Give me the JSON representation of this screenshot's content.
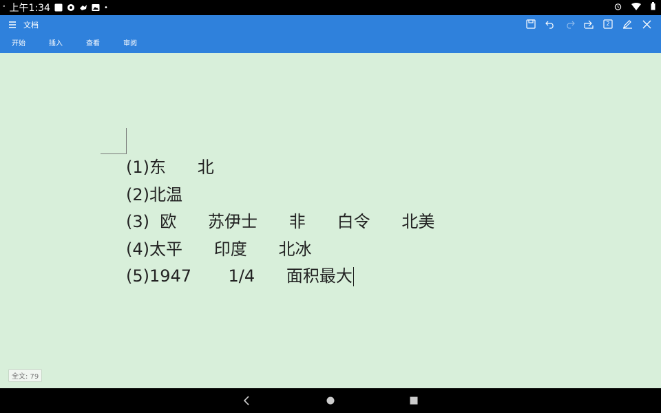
{
  "status_bar": {
    "time": "上午1:34",
    "left_dot": "°",
    "more_dot": "•"
  },
  "app_bar": {
    "title": "文档",
    "tabs": [
      {
        "label": "开始"
      },
      {
        "label": "插入"
      },
      {
        "label": "查看"
      },
      {
        "label": "审阅"
      }
    ],
    "page_badge": "2"
  },
  "document": {
    "lines": [
      "(1)东      北",
      "(2)北温",
      "(3)  欧      苏伊士      非      白令      北美",
      "(4)太平      印度      北冰",
      "(5)1947       1/4      面积最大"
    ]
  },
  "word_count": "全文: 79",
  "colors": {
    "app_bar": "#2f81dc",
    "document_background": "#d8efda"
  }
}
